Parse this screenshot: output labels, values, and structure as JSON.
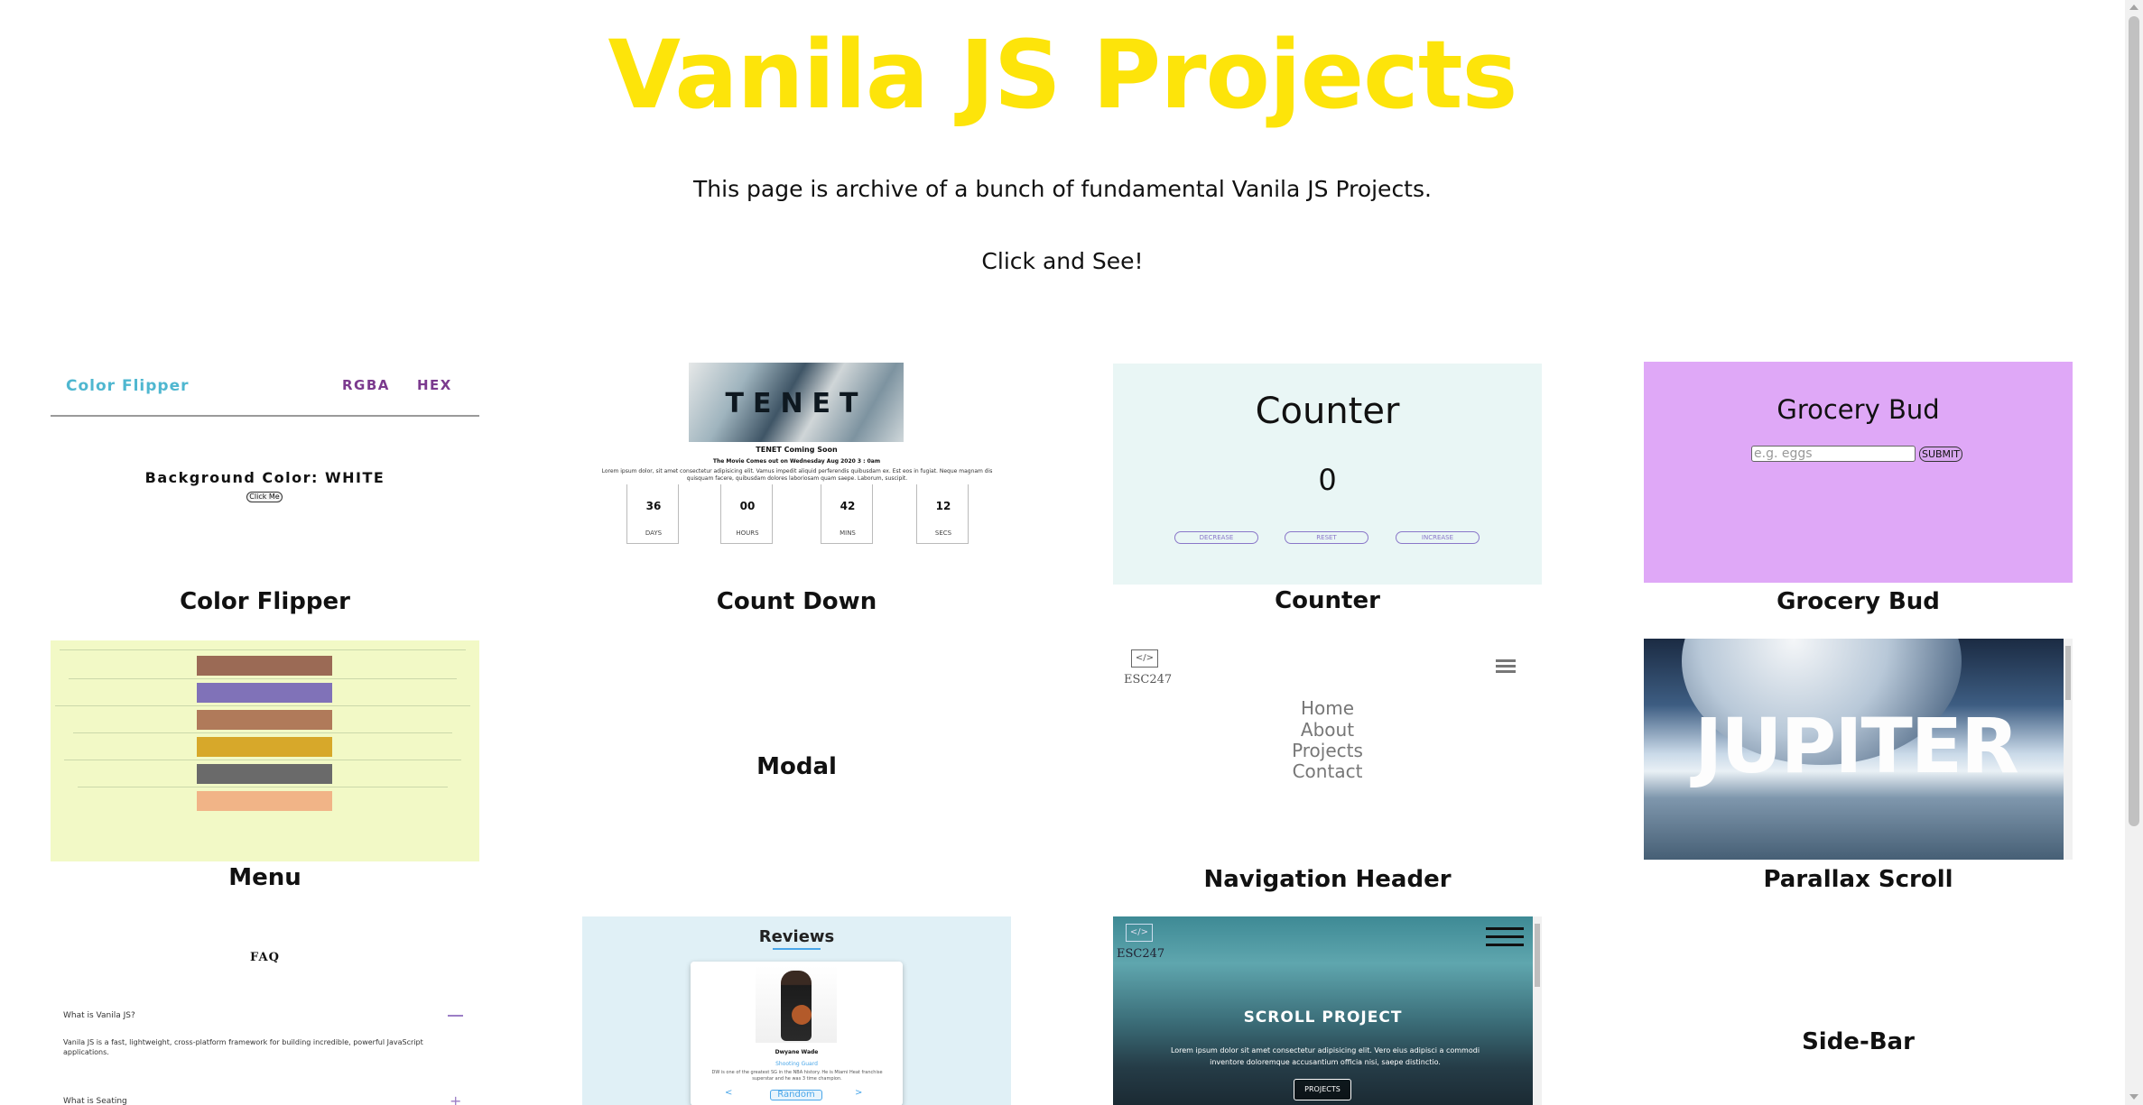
{
  "page": {
    "title": "Vanila JS Projects",
    "subtitle": "This page is archive of a bunch of fundamental Vanila JS Projects.",
    "cta": "Click and See!",
    "accent_color": "#fde40a"
  },
  "projects": [
    {
      "label": "Color Flipper"
    },
    {
      "label": "Count Down"
    },
    {
      "label": "Counter"
    },
    {
      "label": "Grocery Bud"
    },
    {
      "label": "Menu"
    },
    {
      "label": "Modal"
    },
    {
      "label": "Navigation Header"
    },
    {
      "label": "Parallax Scroll"
    },
    {
      "label": "Side-Bar"
    }
  ],
  "previews": {
    "color_flipper": {
      "brand": "Color Flipper",
      "links": [
        "RGBA",
        "HEX"
      ],
      "background_text": "Background Color: WHITE",
      "button": "Click Me"
    },
    "countdown": {
      "poster_word": "TENET",
      "heading": "TENET Coming Soon",
      "date_line": "The Movie Comes out on Wednesday Aug 2020 3 : 0am",
      "body": "Lorem ipsum dolor, sit amet consectetur adipisicing elit. Vamus impedit aliquid perferendis quibusdam ex. Est eos in fugiat. Neque magnam dis quisquam facere, quibusdam dolores laboriosam quam saepe. Laborum, suscipit.",
      "boxes": [
        {
          "value": "36",
          "unit": "DAYS"
        },
        {
          "value": "00",
          "unit": "HOURS"
        },
        {
          "value": "42",
          "unit": "MINS"
        },
        {
          "value": "12",
          "unit": "SECS"
        }
      ]
    },
    "counter": {
      "title": "Counter",
      "value": "0",
      "buttons": [
        "DECREASE",
        "RESET",
        "INCREASE"
      ],
      "background": "#e9f6f5"
    },
    "grocery": {
      "title": "Grocery Bud",
      "placeholder": "e.g. eggs",
      "submit": "SUBMIT",
      "background": "#dfa8f7"
    },
    "menu": {
      "background": "#f2f9c6",
      "stripe_colors": [
        "#9b6a55",
        "#8072b8",
        "#b07a5a",
        "#d7a82a",
        "#6a6a6a",
        "#f1b487"
      ]
    },
    "navigation": {
      "logo": "</>",
      "brand": "ESC247",
      "links": [
        "Home",
        "About",
        "Projects",
        "Contact"
      ]
    },
    "parallax": {
      "heading": "JUPITER"
    },
    "faq": {
      "title": "FAQ",
      "q1": "What is Vanila JS?",
      "a1": "Vanila JS is a fast, lightweight, cross-platform framework for building incredible, powerful JavaScript applications.",
      "q2": "What is Seating"
    },
    "reviews": {
      "title": "Reviews",
      "name": "Dwyane Wade",
      "job": "Shooting Guard",
      "text": "DW is one of the greatest SG in the NBA history. He is Miami Heat franchise superstar and he was 3 time champion.",
      "random": "Random",
      "prev": "<",
      "next": ">"
    },
    "scroll_project": {
      "logo": "</>",
      "brand": "ESC247",
      "title": "SCROLL PROJECT",
      "text": "Lorem ipsum dolor sit amet consectetur adipisicing elit. Vero eius adipisci a commodi inventore doloremque accusantium officia nisi, saepe distinctio.",
      "button": "PROJECTS"
    }
  }
}
